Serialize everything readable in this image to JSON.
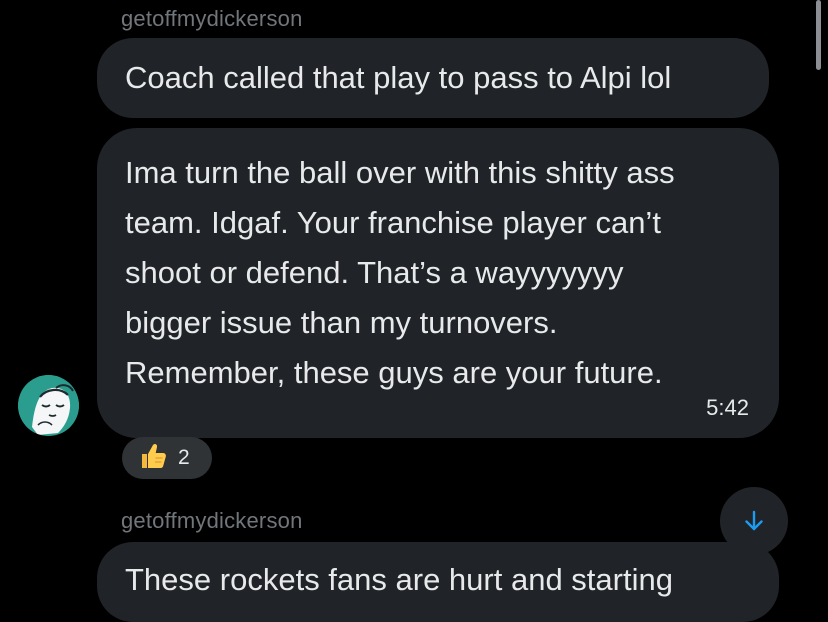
{
  "messages": [
    {
      "username": "getoffmydickerson",
      "text": "Coach called that play to pass to Alpi lol"
    },
    {
      "lines": [
        "Ima turn the ball over with this shitty ass",
        "team. Idgaf. Your franchise player can’t",
        "shoot or defend. That’s a wayyyyyyy",
        "bigger issue than my turnovers.",
        "Remember, these guys are your future."
      ],
      "time": "5:42",
      "reaction": {
        "emoji": "thumbs-up-icon",
        "count": "2"
      }
    },
    {
      "username": "getoffmydickerson",
      "text": "These rockets fans are hurt and starting"
    }
  ],
  "colors": {
    "background": "#000000",
    "bubble": "#202327",
    "username": "#71767b",
    "accent": "#1d9bf0",
    "avatar": "#2a9d8f"
  },
  "icons": {
    "scroll_down": "arrow-down-icon"
  }
}
